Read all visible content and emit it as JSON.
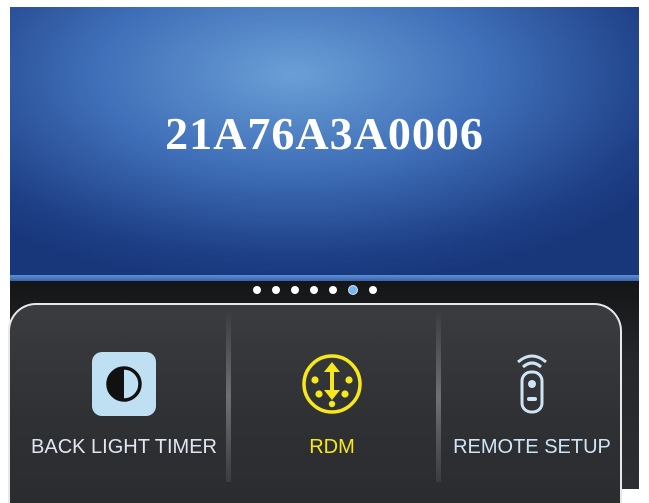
{
  "display": {
    "serial": "21A76A3A0006"
  },
  "pager": {
    "count": 7,
    "active_index": 5
  },
  "menu": {
    "items": [
      {
        "label": "BACK LIGHT TIMER",
        "icon": "contrast-icon",
        "color": "#dfe6ef"
      },
      {
        "label": "RDM",
        "icon": "rdm-connector-icon",
        "color": "#f6e81a"
      },
      {
        "label": "REMOTE SETUP",
        "icon": "remote-control-icon",
        "color": "#cfe4f5"
      }
    ]
  },
  "colors": {
    "screen_blue": "#3f6fb8",
    "accent_yellow": "#f6e81a",
    "active_dot": "#79b6ec"
  }
}
